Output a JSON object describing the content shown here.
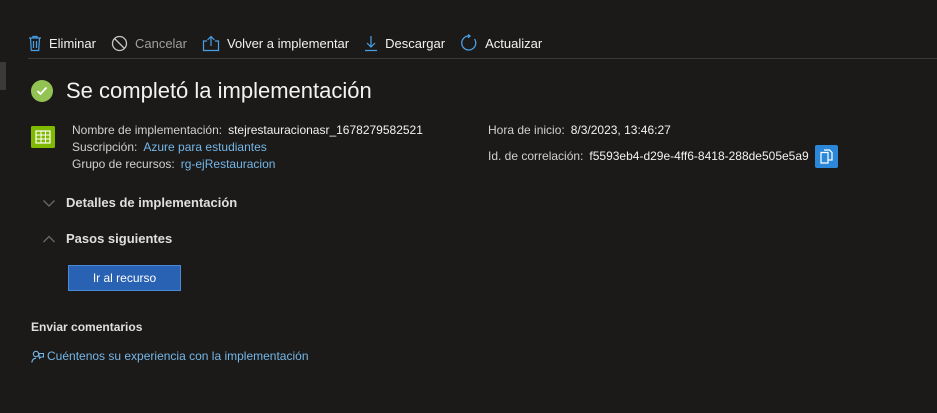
{
  "toolbar": {
    "delete_label": "Eliminar",
    "cancel_label": "Cancelar",
    "redeploy_label": "Volver a implementar",
    "download_label": "Descargar",
    "refresh_label": "Actualizar"
  },
  "title": "Se completó la implementación",
  "summary": {
    "deployment_name_label": "Nombre de implementación:",
    "deployment_name": "stejrestauracionasr_1678279582521",
    "subscription_label": "Suscripción:",
    "subscription": "Azure para estudiantes",
    "resource_group_label": "Grupo de recursos:",
    "resource_group": "rg-ejRestauracion",
    "start_time_label": "Hora de inicio:",
    "start_time": "8/3/2023, 13:46:27",
    "correlation_id_label": "Id. de correlación:",
    "correlation_id": "f5593eb4-d29e-4ff6-8418-288de505e5a9"
  },
  "sections": {
    "details_title": "Detalles de implementación",
    "next_steps_title": "Pasos siguientes"
  },
  "go_to_resource_label": "Ir al recurso",
  "feedback": {
    "title": "Enviar comentarios",
    "link": "Cuéntenos su experiencia con la implementación"
  },
  "colors": {
    "background": "#1b1a19",
    "success": "#92c353",
    "link": "#75b6e7",
    "primary_button": "#2a62b3",
    "copy_button": "#2b88d8"
  }
}
